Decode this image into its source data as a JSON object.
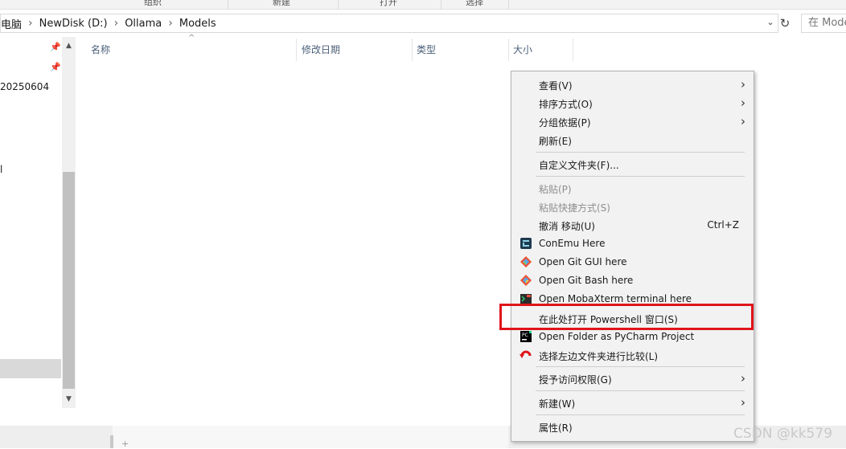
{
  "ribbon": {
    "groups": [
      "组织",
      "新建",
      "打开",
      "选择"
    ]
  },
  "address": {
    "crumbs": [
      "电脑",
      "NewDisk (D:)",
      "Ollama",
      "Models"
    ],
    "search_placeholder": "在 Models 中搜索"
  },
  "nav": {
    "items": [
      "20250604",
      "l"
    ]
  },
  "columns": {
    "name": "名称",
    "modified": "修改日期",
    "type": "类型",
    "size": "大小"
  },
  "menu": {
    "view": "查看(V)",
    "sort": "排序方式(O)",
    "group": "分组依据(P)",
    "refresh": "刷新(E)",
    "customize": "自定义文件夹(F)...",
    "paste": "粘贴(P)",
    "paste_shortcut": "粘贴快捷方式(S)",
    "undo": "撤消 移动(U)",
    "undo_shortcut": "Ctrl+Z",
    "conemu": "ConEmu Here",
    "git_gui": "Open Git GUI here",
    "git_bash": "Open Git Bash here",
    "mobaxterm": "Open MobaXterm terminal here",
    "powershell": "在此处打开 Powershell 窗口(S)",
    "pycharm": "Open Folder as PyCharm Project",
    "compare": "选择左边文件夹进行比较(L)",
    "grant": "授予访问权限(G)",
    "new": "新建(W)",
    "properties": "属性(R)"
  },
  "watermark": "CSDN @kk579",
  "colors": {
    "highlight_border": "#e0151b",
    "menu_bg": "#f2f2f2"
  }
}
